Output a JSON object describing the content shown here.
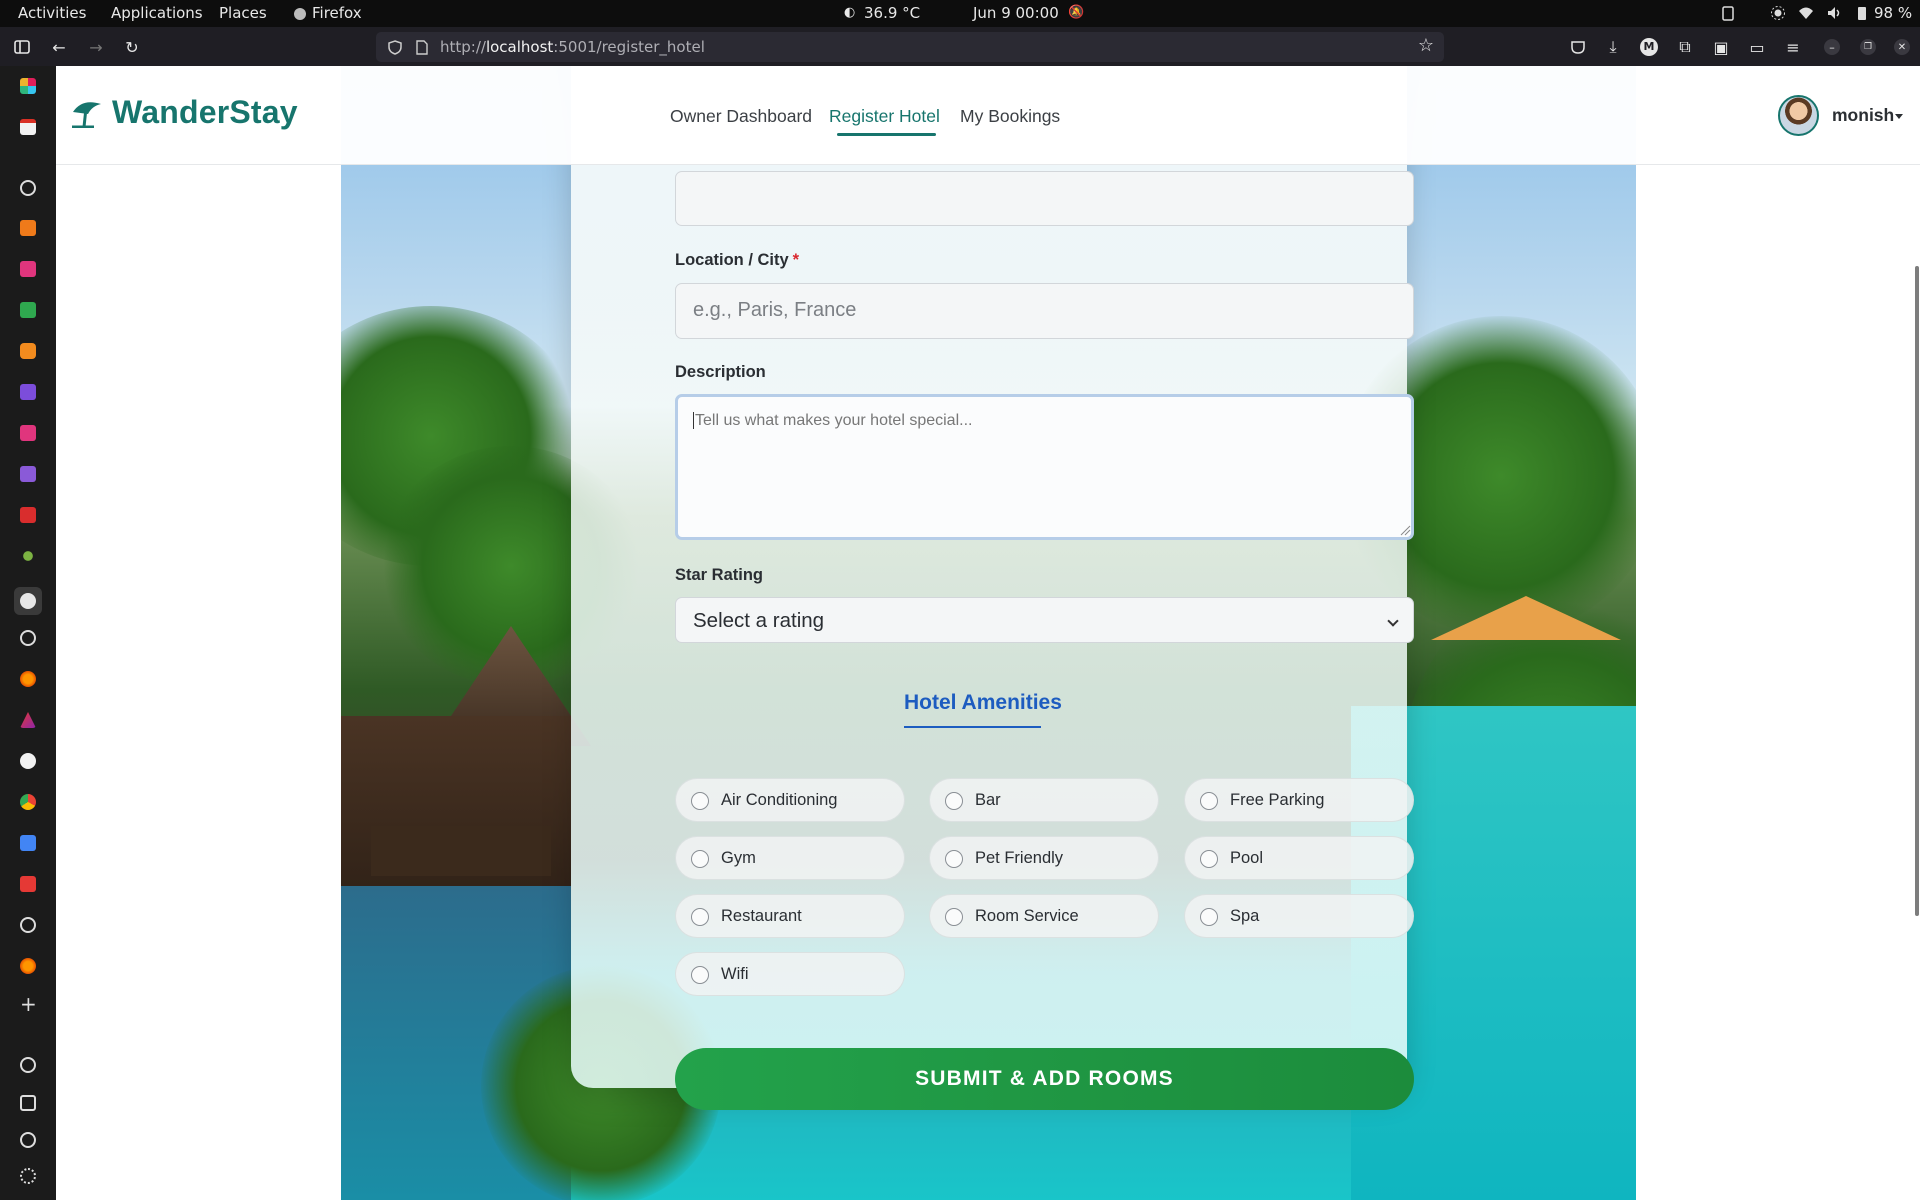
{
  "system_bar": {
    "activities": "Activities",
    "applications": "Applications",
    "places": "Places",
    "active_app": "Firefox",
    "temperature": "36.9 °C",
    "datetime": "Jun 9  00:00",
    "battery": "98 %"
  },
  "browser": {
    "url_prefix": "http://",
    "url_host": "localhost",
    "url_rest": ":5001/register_hotel"
  },
  "site": {
    "brand": "WanderStay",
    "nav": {
      "owner_dashboard": "Owner Dashboard",
      "register_hotel": "Register Hotel",
      "my_bookings": "My Bookings"
    },
    "user": "monish"
  },
  "form": {
    "hotel_name_value": "",
    "location_label": "Location / City",
    "required_mark": "*",
    "location_placeholder": "e.g., Paris, France",
    "description_label": "Description",
    "description_placeholder": "Tell us what makes your hotel special...",
    "star_rating_label": "Star Rating",
    "star_rating_value": "Select a rating",
    "amenities_title": "Hotel Amenities",
    "amenities": [
      "Air Conditioning",
      "Bar",
      "Free Parking",
      "Gym",
      "Pet Friendly",
      "Pool",
      "Restaurant",
      "Room Service",
      "Spa",
      "Wifi"
    ],
    "submit_label": "SUBMIT & ADD ROOMS"
  },
  "colors": {
    "brand_teal": "#17756d",
    "amenities_blue": "#1d5cc0",
    "submit_green": "#23a24b",
    "required_red": "#d9262c"
  }
}
